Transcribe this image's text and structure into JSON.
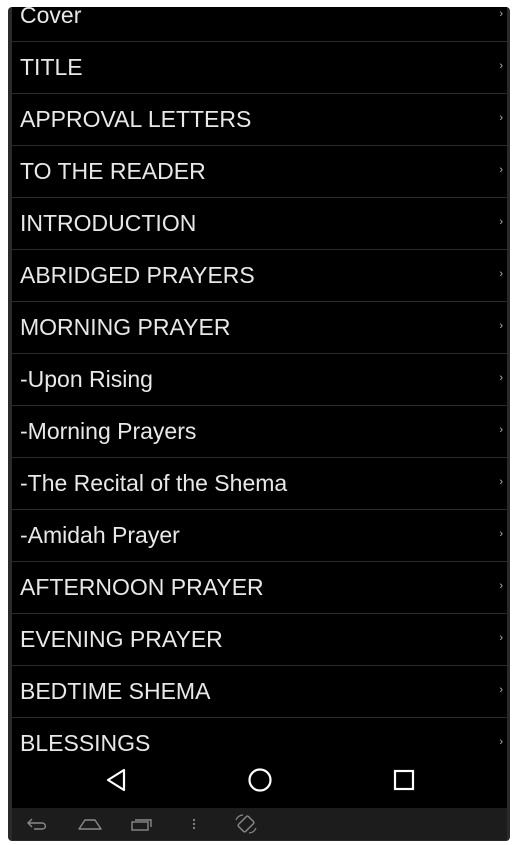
{
  "toc": {
    "items": [
      {
        "label": "Cover"
      },
      {
        "label": "TITLE"
      },
      {
        "label": "APPROVAL LETTERS"
      },
      {
        "label": "TO THE READER"
      },
      {
        "label": "INTRODUCTION"
      },
      {
        "label": "ABRIDGED PRAYERS"
      },
      {
        "label": "MORNING PRAYER"
      },
      {
        "label": "-Upon Rising"
      },
      {
        "label": "-Morning Prayers"
      },
      {
        "label": "-The Recital of the Shema"
      },
      {
        "label": "-Amidah Prayer"
      },
      {
        "label": "AFTERNOON PRAYER"
      },
      {
        "label": "EVENING PRAYER"
      },
      {
        "label": "BEDTIME SHEMA"
      },
      {
        "label": "BLESSINGS"
      }
    ],
    "chevron": "›"
  },
  "navbar": {
    "buttons": [
      "back-icon",
      "home-icon",
      "recents-icon"
    ]
  },
  "legacy_bar": {
    "buttons": [
      "back-icon",
      "home-icon",
      "recents-icon",
      "menu-icon",
      "rotate-icon"
    ]
  },
  "colors": {
    "background": "#000000",
    "text": "#e8e8e8",
    "divider": "#2b2b2b"
  }
}
